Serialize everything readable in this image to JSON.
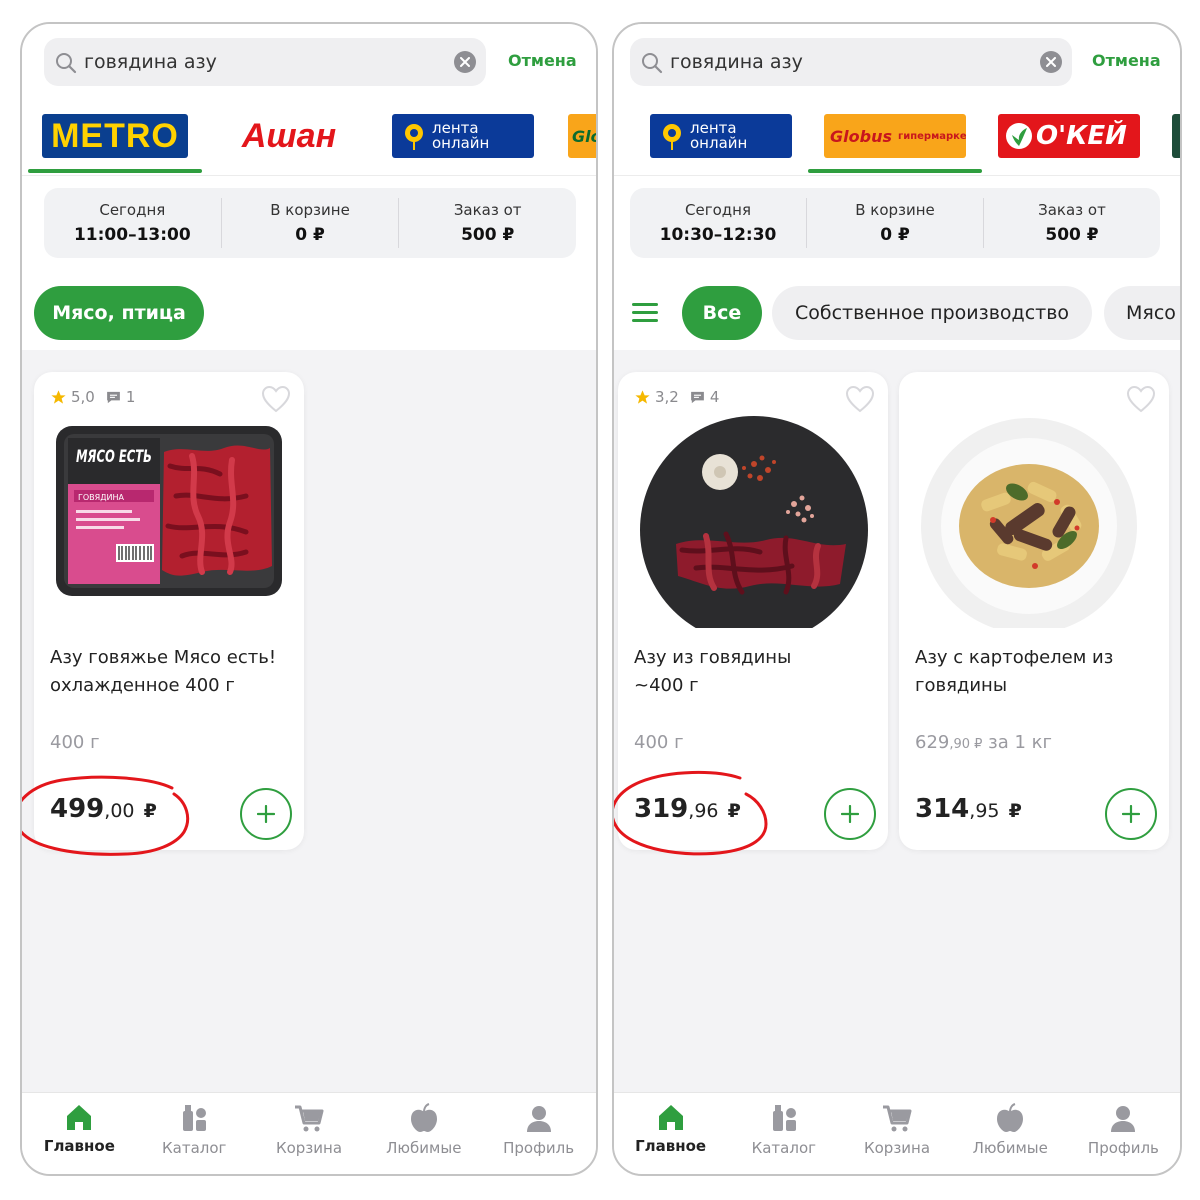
{
  "colors": {
    "accent": "#2f9e3f",
    "annotation": "#e3161b"
  },
  "screens": [
    {
      "search": {
        "query": "говядина азу"
      },
      "cancel_label": "Отмена",
      "stores": [
        "METRO",
        "Ашан",
        "лента онлайн",
        "Globus"
      ],
      "info": [
        {
          "label": "Сегодня",
          "value": "11:00–13:00"
        },
        {
          "label": "В корзине",
          "value": "0 ₽"
        },
        {
          "label": "Заказ от",
          "value": "500 ₽"
        }
      ],
      "chips": [
        "Мясо, птица"
      ],
      "products": [
        {
          "rating": "5,0",
          "reviews": "1",
          "name": "Азу говяжье Мясо есть! охлажденное 400 г",
          "weight": "400 г",
          "price_rub": "499",
          "price_kop": ",00",
          "currency": "₽",
          "pack_brand": "МЯСО ЕСТЬ",
          "pack_line": "ГОВЯДИНА"
        }
      ]
    },
    {
      "search": {
        "query": "говядина азу"
      },
      "cancel_label": "Отмена",
      "stores": [
        "лента онлайн",
        "Globus",
        "гипермаркет",
        "О'КЕЙ"
      ],
      "info": [
        {
          "label": "Сегодня",
          "value": "10:30–12:30"
        },
        {
          "label": "В корзине",
          "value": "0 ₽"
        },
        {
          "label": "Заказ от",
          "value": "500 ₽"
        }
      ],
      "chips": [
        "Все",
        "Собственное производство",
        "Мясо"
      ],
      "products": [
        {
          "rating": "3,2",
          "reviews": "4",
          "name": "Азу из говядины ~400 г",
          "weight": "400 г",
          "price_rub": "319",
          "price_kop": ",96",
          "currency": "₽"
        },
        {
          "name": "Азу с картофелем из говядины",
          "unit_price": "629",
          "unit_kop": ",90 ₽",
          "unit_suffix": " за 1 кг",
          "price_rub": "314",
          "price_kop": ",95",
          "currency": "₽"
        }
      ]
    }
  ],
  "tabs": [
    "Главное",
    "Каталог",
    "Корзина",
    "Любимые",
    "Профиль"
  ]
}
